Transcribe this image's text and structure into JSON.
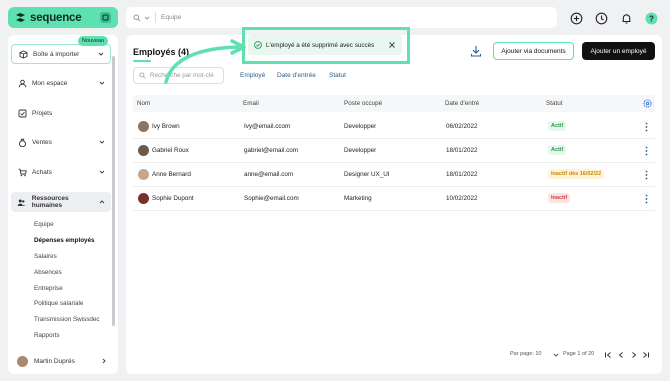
{
  "brand": {
    "name": "sequence"
  },
  "search": {
    "placeholder": "Equipe"
  },
  "sidebar": {
    "items": [
      {
        "label": "Boîte à importer",
        "badge": "Nouveau"
      },
      {
        "label": "Mon espace"
      },
      {
        "label": "Projets"
      },
      {
        "label": "Ventes"
      },
      {
        "label": "Achats"
      },
      {
        "label": "Ressources humaines"
      }
    ],
    "subitems": [
      "Equipe",
      "Dépenses employés",
      "Salaires",
      "Absences",
      "Entreprise",
      "Politique salariale",
      "Transmission Swissdec",
      "Rapports"
    ],
    "user": "Martin Duprés"
  },
  "main": {
    "title": "Employés (4)",
    "buttons": {
      "docs": "Ajouter via documents",
      "add": "Ajouter un employé"
    },
    "search_placeholder": "Recherche par mot-clé",
    "filters": [
      "Employé",
      "Date d'entrée",
      "Statut"
    ],
    "columns": [
      "Nom",
      "Email",
      "Poste occupé",
      "Date d'entré",
      "Statut"
    ],
    "rows": [
      {
        "name": "Ivy Brown",
        "email": "Ivy@email.ccom",
        "role": "Developper",
        "date": "06/02/2022",
        "status": "Actif"
      },
      {
        "name": "Gabriel Roux",
        "email": "gabriel@email.com",
        "role": "Developper",
        "date": "18/01/2022",
        "status": "Actif"
      },
      {
        "name": "Anne Bernard",
        "email": "anne@email.com",
        "role": "Designer UX_UI",
        "date": "18/01/2022",
        "status": "Inactif dès 16/02/22"
      },
      {
        "name": "Sophie Dupont",
        "email": "Sophie@email.com",
        "role": "Marketing",
        "date": "10/02/2022",
        "status": "Inactif"
      }
    ],
    "pagination": {
      "per_page": "Par page: 10",
      "page": "Page 1 of 20"
    }
  },
  "toast": {
    "message": "L'employé a été supprimé avec succès"
  },
  "colors": {
    "accent": "#5fe0b0",
    "dark": "#111111",
    "active_bg": "#e3f7ea",
    "active_fg": "#2f9a4f",
    "warn_bg": "#fff3d6",
    "warn_fg": "#c48a10",
    "inactive_bg": "#fde4e4",
    "inactive_fg": "#d23c3c"
  }
}
